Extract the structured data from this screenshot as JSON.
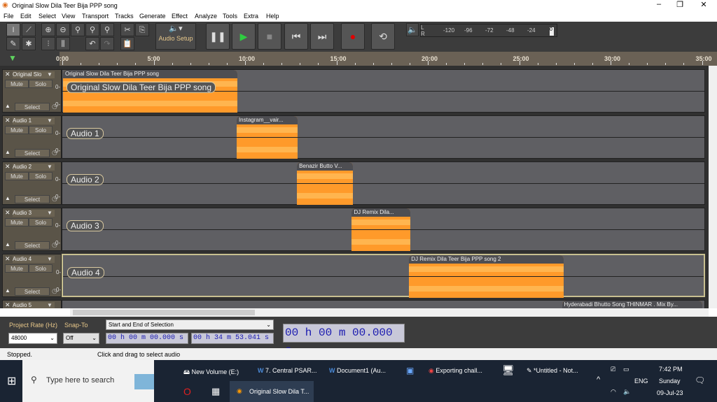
{
  "window": {
    "title": "Original Slow Dila Teer Bija PPP song"
  },
  "menu": [
    "File",
    "Edit",
    "Select",
    "View",
    "Transport",
    "Tracks",
    "Generate",
    "Effect",
    "Analyze",
    "Tools",
    "Extra",
    "Help"
  ],
  "toolbar": {
    "audio_setup": "Audio Setup",
    "meter_ticks": [
      "-120",
      "-96",
      "-72",
      "-48",
      "-24",
      "0"
    ],
    "meter_channels": [
      "L",
      "R"
    ]
  },
  "ruler": {
    "labels": [
      "0:00",
      "5:00",
      "10:00",
      "15:00",
      "20:00",
      "25:00",
      "30:00",
      "35:00"
    ]
  },
  "tracks": [
    {
      "name": "Original Slo",
      "label": "Original Slow Dila Teer Bija PPP song",
      "clip": "Original Slow Dila Teer Bija PPP song",
      "start_min": 0,
      "end_min": 9.55
    },
    {
      "name": "Audio 1",
      "label": "Audio 1",
      "clip": "Instagram__vair...",
      "start_min": 9.5,
      "end_min": 12.85
    },
    {
      "name": "Audio 2",
      "label": "Audio 2",
      "clip": "Benazir Butto V...",
      "start_min": 12.8,
      "end_min": 15.85
    },
    {
      "name": "Audio 3",
      "label": "Audio 3",
      "clip": "DJ Remix Dila...",
      "start_min": 15.8,
      "end_min": 19.0
    },
    {
      "name": "Audio 4",
      "label": "Audio 4",
      "clip": "DJ Remix Dila Teer Bija PPP song 2",
      "start_min": 18.9,
      "end_min": 27.35
    },
    {
      "name": "Audio 5",
      "label": "",
      "clip": "Hyderabadi Bhutto Song THINMAR . Mix By...",
      "start_min": 27.3,
      "end_min": 35.0
    }
  ],
  "track_buttons": {
    "mute": "Mute",
    "solo": "Solo",
    "select": "Select",
    "zero": "0-"
  },
  "bottom": {
    "project_rate_label": "Project Rate (Hz)",
    "project_rate": "48000",
    "snap_label": "Snap-To",
    "snap": "Off",
    "selection_mode": "Start and End of Selection",
    "sel_start": "00 h 00 m 00.000 s",
    "sel_end": "00 h 34 m 53.041 s",
    "position": "00 h 00 m 00.000 s"
  },
  "status": {
    "state": "Stopped.",
    "hint": "Click and drag to select audio"
  },
  "taskbar": {
    "search": "Type here to search",
    "items": [
      "New Volume (E:)",
      "7. Central PSAR...",
      "Document1 (Au...",
      "Exporting chall...",
      "*Untitled - Not...",
      "Original Slow Dila T..."
    ],
    "lang": "ENG",
    "time": "7:42 PM",
    "day": "Sunday",
    "date": "09-Jul-23"
  },
  "colors": {
    "clip": "#ff9a2a",
    "wave": "#ffb54f",
    "track_bg": "#5f5f63",
    "play": "#2ecc40",
    "record": "#e00000"
  }
}
